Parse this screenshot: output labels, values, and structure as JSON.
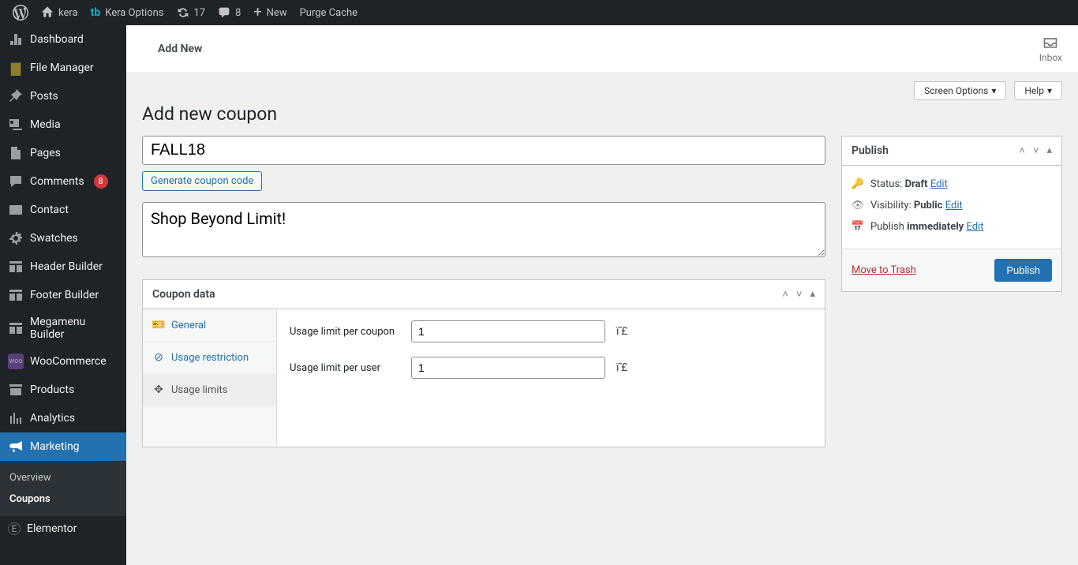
{
  "adminbar": {
    "site_name": "kera",
    "options_label": "Kera Options",
    "updates_count": "17",
    "comments_count": "8",
    "new_label": "New",
    "purge_label": "Purge Cache"
  },
  "sidebar": {
    "items": [
      {
        "label": "Dashboard"
      },
      {
        "label": "File Manager"
      },
      {
        "label": "Posts"
      },
      {
        "label": "Media"
      },
      {
        "label": "Pages"
      },
      {
        "label": "Comments"
      },
      {
        "label": "Contact"
      },
      {
        "label": "Swatches"
      },
      {
        "label": "Header Builder"
      },
      {
        "label": "Footer Builder"
      },
      {
        "label": "Megamenu Builder"
      },
      {
        "label": "WooCommerce"
      },
      {
        "label": "Products"
      },
      {
        "label": "Analytics"
      },
      {
        "label": "Marketing"
      },
      {
        "label": "Elementor"
      }
    ],
    "comments_badge": "8",
    "submenu": {
      "overview": "Overview",
      "coupons": "Coupons"
    }
  },
  "header": {
    "strip_title": "Add New",
    "inbox_label": "Inbox",
    "screen_options": "Screen Options",
    "help": "Help"
  },
  "page": {
    "title": "Add new coupon",
    "coupon_code": "FALL18",
    "generate_btn": "Generate coupon code",
    "description": "Shop Beyond Limit!",
    "coupon_data_heading": "Coupon data",
    "tabs": {
      "general": "General",
      "usage_restriction": "Usage restriction",
      "usage_limits": "Usage limits"
    },
    "fields": {
      "limit_coupon_label": "Usage limit per coupon",
      "limit_coupon_value": "1",
      "limit_user_label": "Usage limit per user",
      "limit_user_value": "1"
    }
  },
  "publish": {
    "heading": "Publish",
    "status_label": "Status:",
    "status_value": "Draft",
    "visibility_label": "Visibility:",
    "visibility_value": "Public",
    "publish_label": "Publish",
    "publish_value": "immediately",
    "edit": "Edit",
    "trash": "Move to Trash",
    "publish_btn": "Publish"
  }
}
